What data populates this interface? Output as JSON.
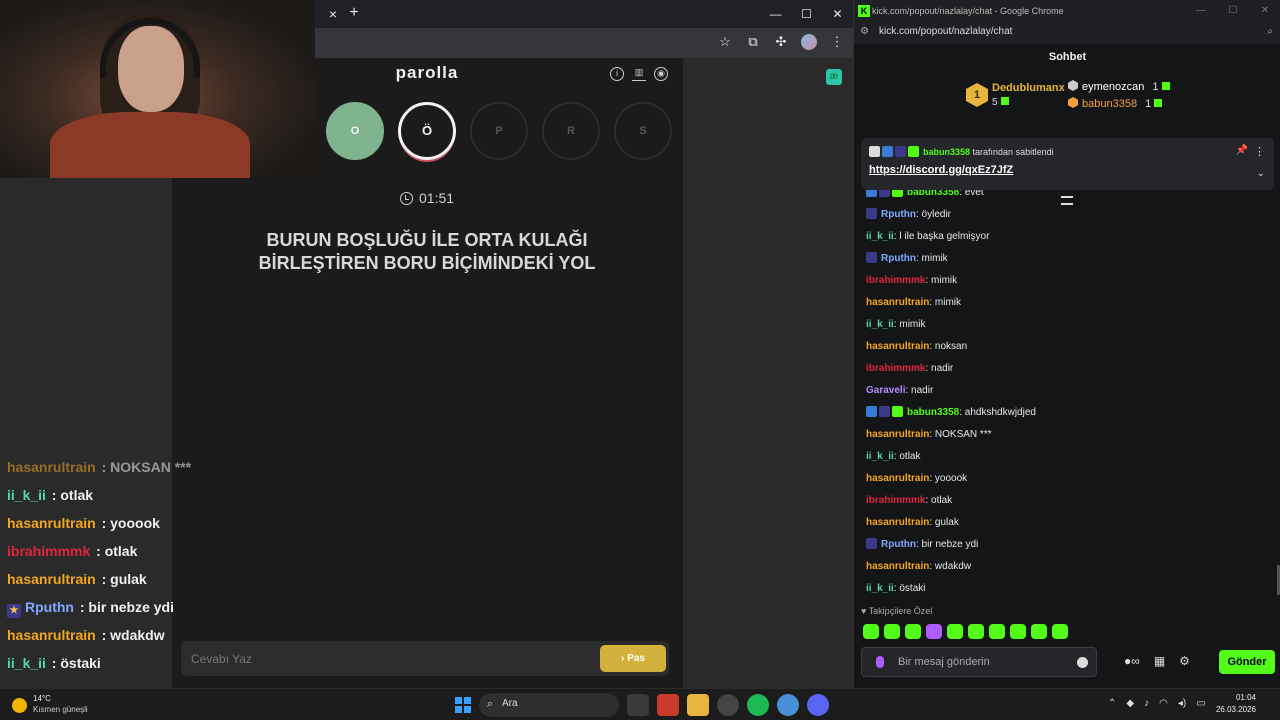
{
  "game": {
    "title": "parolla",
    "letters": [
      {
        "label": "O",
        "state": "done"
      },
      {
        "label": "Ö",
        "state": "active"
      },
      {
        "label": "P",
        "state": "pending"
      },
      {
        "label": "R",
        "state": "pending"
      },
      {
        "label": "S",
        "state": "pending"
      }
    ],
    "timer": "01:51",
    "question": "BURUN BOŞLUĞU İLE ORTA KULAĞI BİRLEŞTİREN BORU BİÇİMİNDEKİ YOL",
    "answer_placeholder": "Cevabı Yaz",
    "pass_label": "› Pas",
    "icons": [
      "info-icon",
      "stats-icon",
      "profile-icon"
    ]
  },
  "browser": {
    "close_tab": "×",
    "new_tab": "+",
    "window_controls": [
      "—",
      "☐",
      "✕"
    ]
  },
  "overlay_chat": [
    {
      "user": "hasanrultrain",
      "color": "#f5a623",
      "text": " : NOKSAN ***",
      "faded": true
    },
    {
      "user": "ii_k_ii",
      "color": "#54d9a3",
      "text": " : otlak"
    },
    {
      "user": "hasanrultrain",
      "color": "#f5a623",
      "text": " : yooook"
    },
    {
      "user": "ibrahimmmk",
      "color": "#e0263e",
      "text": " : otlak"
    },
    {
      "user": "hasanrultrain",
      "color": "#f5a623",
      "text": " : gulak"
    },
    {
      "user": "Rputhn",
      "color": "#7fa9ff",
      "text": " : bir nebze ydi",
      "badge": true
    },
    {
      "user": "hasanrultrain",
      "color": "#f5a623",
      "text": " : wdakdw"
    },
    {
      "user": "ii_k_ii",
      "color": "#54d9a3",
      "text": " : östaki"
    }
  ],
  "chat": {
    "window_title": "kick.com/popout/nazlalay/chat - Google Chrome",
    "url": "kick.com/popout/nazlalay/chat",
    "header": "Sohbet",
    "leaderboard": {
      "rank": "1",
      "first_user": "Dedublumanx",
      "first_count": "5",
      "others": [
        {
          "user": "eymenozcan",
          "count": "1",
          "color": "#ffffff"
        },
        {
          "user": "babun3358",
          "count": "1",
          "color": "#f5a040"
        }
      ]
    },
    "pinned": {
      "by_user": "babun3358",
      "by_text": " tarafından sabitlendi",
      "link": "https://discord.gg/qxEz7JfZ"
    },
    "messages": [
      {
        "user": "babun3358",
        "color": "#53fc18",
        "text": ": evet",
        "badges": true
      },
      {
        "user": "Rputhn",
        "color": "#7fa9ff",
        "text": ": öyledir",
        "star": true
      },
      {
        "user": "ii_k_ii",
        "color": "#54d9a3",
        "text": ": l ile başka gelmişyor"
      },
      {
        "user": "Rputhn",
        "color": "#7fa9ff",
        "text": ": mimik",
        "star": true
      },
      {
        "user": "ibrahimmmk",
        "color": "#e0263e",
        "text": ": mimik"
      },
      {
        "user": "hasanrultrain",
        "color": "#f5a623",
        "text": ": mimik"
      },
      {
        "user": "ii_k_ii",
        "color": "#54d9a3",
        "text": ": mimik"
      },
      {
        "user": "hasanrultrain",
        "color": "#f5a623",
        "text": ": noksan"
      },
      {
        "user": "ibrahimmmk",
        "color": "#e0263e",
        "text": ": nadir"
      },
      {
        "user": "Garaveli",
        "color": "#b58cff",
        "text": ": nadir"
      },
      {
        "user": "babun3358",
        "color": "#53fc18",
        "text": ": ahdkshdkwjdjed",
        "badges": true
      },
      {
        "user": "hasanrultrain",
        "color": "#f5a623",
        "text": ": NOKSAN ***"
      },
      {
        "user": "ii_k_ii",
        "color": "#54d9a3",
        "text": ": otlak"
      },
      {
        "user": "hasanrultrain",
        "color": "#f5a623",
        "text": ": yooook"
      },
      {
        "user": "ibrahimmmk",
        "color": "#e0263e",
        "text": ": otlak"
      },
      {
        "user": "hasanrultrain",
        "color": "#f5a623",
        "text": ": gulak"
      },
      {
        "user": "Rputhn",
        "color": "#7fa9ff",
        "text": ": bir nebze ydi",
        "star": true
      },
      {
        "user": "hasanrultrain",
        "color": "#f5a623",
        "text": ": wdakdw"
      },
      {
        "user": "ii_k_ii",
        "color": "#54d9a3",
        "text": ": östaki"
      }
    ],
    "follower_only": "♥ Takipçilere Özel",
    "input_placeholder": "Bir mesaj gönderin",
    "send_label": "Gönder"
  },
  "taskbar": {
    "temp": "14°C",
    "weather": "Kısmen güneşli",
    "search": "Ara",
    "time": "01:04",
    "date": "26.03.2026"
  },
  "colors": {
    "kick_green": "#53fc18",
    "done_green": "#7fb38d",
    "pass_yellow": "#d4b03c"
  }
}
